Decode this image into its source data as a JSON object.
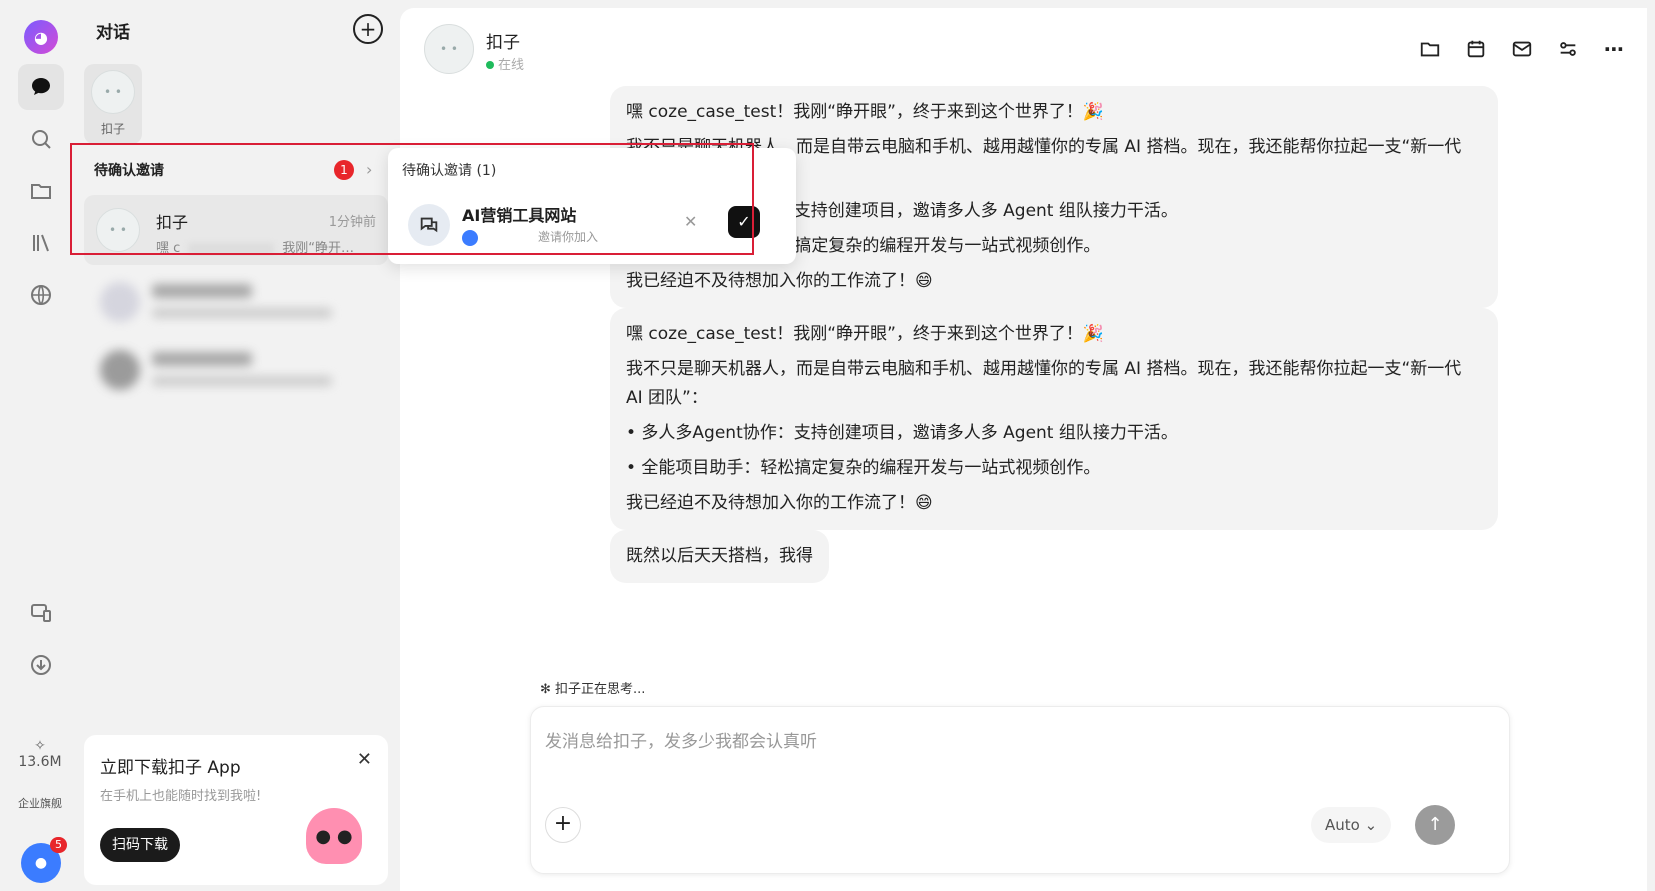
{
  "rail": {
    "logo_icon": "app-logo-icon",
    "items": [
      {
        "name": "chat-icon"
      },
      {
        "name": "search-icon"
      },
      {
        "name": "folder-icon"
      },
      {
        "name": "library-icon"
      },
      {
        "name": "globe-icon"
      },
      {
        "name": "devices-icon"
      },
      {
        "name": "download-icon"
      }
    ],
    "quota": "13.6M",
    "enterprise": "企业旗舰",
    "avatar_badge": "5"
  },
  "conversations": {
    "header": "对话",
    "pinned_label": "扣子",
    "pending_label": "待确认邀请",
    "pending_count": "1",
    "item": {
      "name": "扣子",
      "time": "1分钟前",
      "preview_prefix": "嘿 c",
      "preview_suffix": "我刚“睁开…"
    }
  },
  "promo": {
    "title": "立即下载扣子 App",
    "subtitle": "在手机上也能随时找到我啦!",
    "button": "扫码下载"
  },
  "invite_popover": {
    "header": "待确认邀请 (1)",
    "title": "AI营销工具网站",
    "subtitle": "邀请你加入"
  },
  "chat": {
    "title": "扣子",
    "status": "在线",
    "messages": [
      {
        "lines": [
          "嘿 coze_case_test！我刚“睁开眼”，终于来到这个世界了！🎉",
          "我不只是聊天机器人，而是自带云电脑和手机、越用越懂你的专属 AI 搭档。现在，我还能帮你拉起一支“新一代 AI 团队”：",
          "• 多人多Agent协作：支持创建项目，邀请多人多 Agent 组队接力干活。",
          "• 全能项目助手：轻松搞定复杂的编程开发与一站式视频创作。",
          "我已经迫不及待想加入你的工作流了！😄"
        ]
      },
      {
        "lines": [
          "嘿 coze_case_test！我刚“睁开眼”，终于来到这个世界了！🎉",
          "我不只是聊天机器人，而是自带云电脑和手机、越用越懂你的专属 AI 搭档。现在，我还能帮你拉起一支“新一代 AI 团队”：",
          "• 多人多Agent协作：支持创建项目，邀请多人多 Agent 组队接力干活。",
          "• 全能项目助手：轻松搞定复杂的编程开发与一站式视频创作。",
          "我已经迫不及待想加入你的工作流了！😄"
        ]
      },
      {
        "lines": [
          "既然以后天天搭档，我得"
        ]
      }
    ]
  },
  "composer": {
    "thinking": "扣子正在思考...",
    "placeholder": "发消息给扣子，发多少我都会认真听",
    "model": "Auto"
  },
  "colors": {
    "highlight": "#d91e36",
    "online": "#1fbb5c",
    "badge": "#e8262b"
  }
}
